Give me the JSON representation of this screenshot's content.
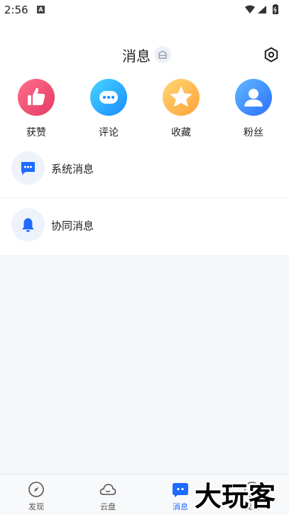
{
  "status_bar": {
    "time": "2:56",
    "notification_icon": "A"
  },
  "header": {
    "title": "消息"
  },
  "quick_actions": [
    {
      "label": "获赞",
      "icon": "thumbs-up-icon",
      "colors": [
        "#ff5f7e",
        "#e8365f"
      ]
    },
    {
      "label": "评论",
      "icon": "comment-icon",
      "colors": [
        "#3ed0ff",
        "#1b8cff"
      ]
    },
    {
      "label": "收藏",
      "icon": "star-icon",
      "colors": [
        "#ffd16a",
        "#ffa43a"
      ]
    },
    {
      "label": "粉丝",
      "icon": "user-icon",
      "colors": [
        "#5fb3ff",
        "#2a76ff"
      ]
    }
  ],
  "message_rows": [
    {
      "label": "系统消息",
      "icon": "chat-icon"
    },
    {
      "label": "协同消息",
      "icon": "bell-icon"
    }
  ],
  "tabbar": {
    "tabs": [
      {
        "label": "发现",
        "icon": "compass-icon"
      },
      {
        "label": "云盘",
        "icon": "cloud-icon"
      },
      {
        "label": "消息",
        "icon": "message-icon",
        "active": true
      },
      {
        "label": "我的",
        "icon": "profile-icon"
      }
    ]
  },
  "watermark": {
    "text": "大玩客"
  },
  "colors": {
    "accent": "#1f6bff"
  }
}
